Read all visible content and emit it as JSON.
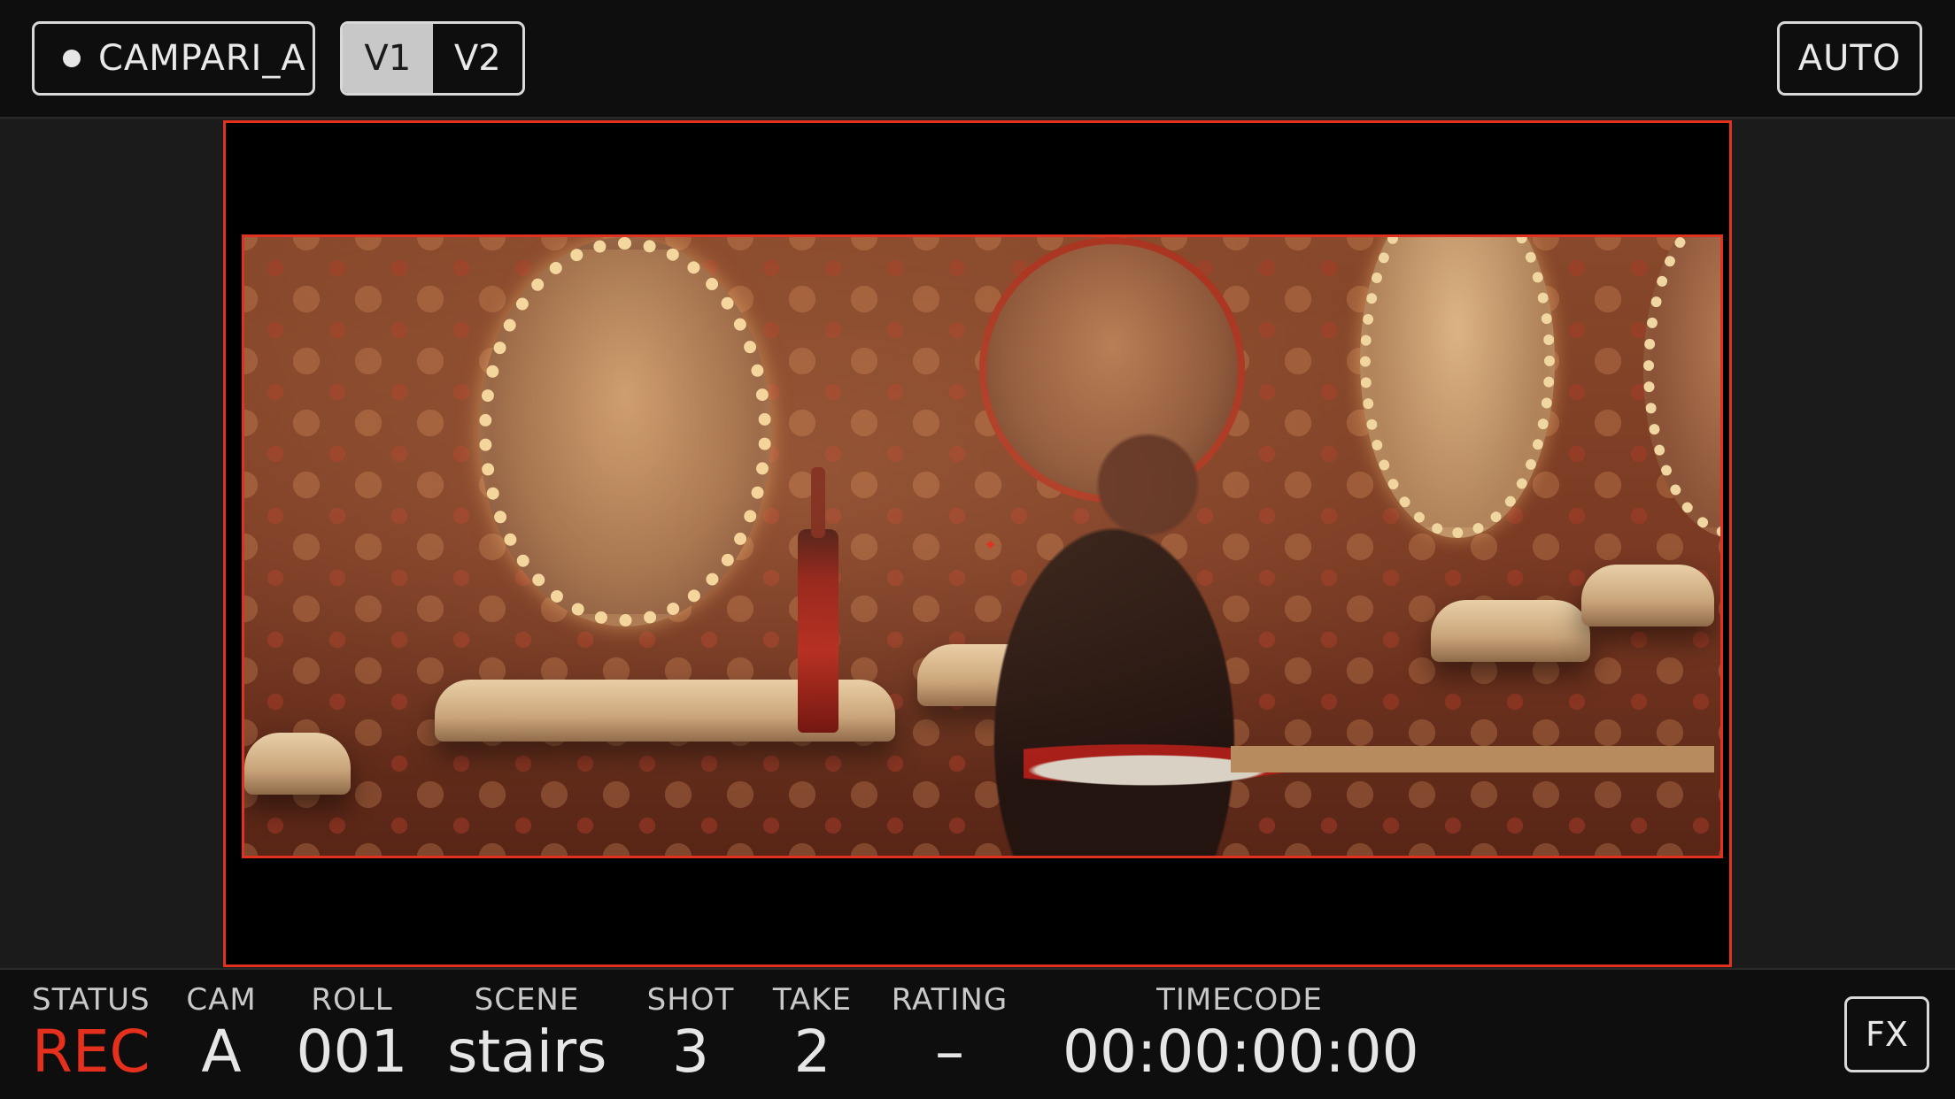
{
  "topbar": {
    "camera_label": "CAMPARI_A",
    "views": [
      {
        "label": "V1",
        "active": true
      },
      {
        "label": "V2",
        "active": false
      }
    ],
    "auto_label": "AUTO"
  },
  "viewer": {
    "border_color": "#e0321e",
    "center_mark": "✦"
  },
  "bottombar": {
    "status": {
      "label": "STATUS",
      "value": "REC"
    },
    "cam": {
      "label": "CAM",
      "value": "A"
    },
    "roll": {
      "label": "ROLL",
      "value": "001"
    },
    "scene": {
      "label": "SCENE",
      "value": "stairs"
    },
    "shot": {
      "label": "SHOT",
      "value": "3"
    },
    "take": {
      "label": "TAKE",
      "value": "2"
    },
    "rating": {
      "label": "RATING",
      "value": "–"
    },
    "timecode": {
      "label": "TIMECODE",
      "value": "00:00:00:00"
    },
    "fx_label": "FX"
  },
  "colors": {
    "accent_red": "#e0321e",
    "rec_red": "#e5301d",
    "bar_bg": "#0e0e0e"
  }
}
